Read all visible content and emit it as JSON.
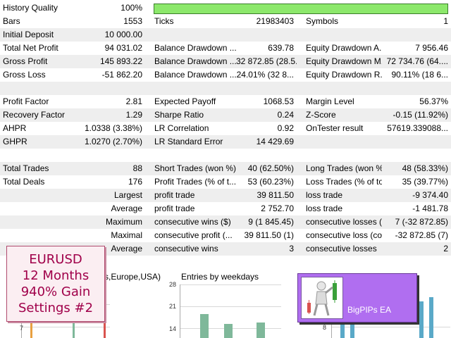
{
  "history_quality": {
    "label": "History Quality",
    "value": "100%",
    "fill_fraction": 1.0
  },
  "rows": [
    {
      "c1l": "Bars",
      "c1v": "1553",
      "c2l": "Ticks",
      "c2v": "21983403",
      "c3l": "Symbols",
      "c3v": "1"
    },
    {
      "c1l": "Initial Deposit",
      "c1v": "10 000.00",
      "c2l": "",
      "c2v": "",
      "c3l": "",
      "c3v": ""
    },
    {
      "c1l": "Total Net Profit",
      "c1v": "94 031.02",
      "c2l": "Balance Drawdown ...",
      "c2v": "639.78",
      "c3l": "Equity Drawdown A...",
      "c3v": "7 956.46"
    },
    {
      "c1l": "Gross Profit",
      "c1v": "145 893.22",
      "c2l": "Balance Drawdown ...",
      "c2v": "32 872.85 (28.5...",
      "c3l": "Equity Drawdown M...",
      "c3v": "72 734.76 (64...."
    },
    {
      "c1l": "Gross Loss",
      "c1v": "-51 862.20",
      "c2l": "Balance Drawdown ...",
      "c2v": "24.01% (32 8...",
      "c3l": "Equity Drawdown R...",
      "c3v": "90.11% (18 6..."
    },
    {
      "c1l": "",
      "c1v": "",
      "c2l": "",
      "c2v": "",
      "c3l": "",
      "c3v": ""
    },
    {
      "c1l": "Profit Factor",
      "c1v": "2.81",
      "c2l": "Expected Payoff",
      "c2v": "1068.53",
      "c3l": "Margin Level",
      "c3v": "56.37%"
    },
    {
      "c1l": "Recovery Factor",
      "c1v": "1.29",
      "c2l": "Sharpe Ratio",
      "c2v": "0.24",
      "c3l": "Z-Score",
      "c3v": "-0.15 (11.92%)"
    },
    {
      "c1l": "AHPR",
      "c1v": "1.0338 (3.38%)",
      "c2l": "LR Correlation",
      "c2v": "0.92",
      "c3l": "OnTester result",
      "c3v": "57619.339088..."
    },
    {
      "c1l": "GHPR",
      "c1v": "1.0270 (2.70%)",
      "c2l": "LR Standard Error",
      "c2v": "14 429.69",
      "c3l": "",
      "c3v": ""
    },
    {
      "c1l": "",
      "c1v": "",
      "c2l": "",
      "c2v": "",
      "c3l": "",
      "c3v": ""
    },
    {
      "c1l": "Total Trades",
      "c1v": "88",
      "c2l": "Short Trades (won %)",
      "c2v": "40 (62.50%)",
      "c3l": "Long Trades (won %)",
      "c3v": "48 (58.33%)"
    },
    {
      "c1l": "Total Deals",
      "c1v": "176",
      "c2l": "Profit Trades (% of t...",
      "c2v": "53 (60.23%)",
      "c3l": "Loss Trades (% of to...",
      "c3v": "35 (39.77%)"
    },
    {
      "c1l": "",
      "c1v": "Largest",
      "c2l": "profit trade",
      "c2v": "39 811.50",
      "c3l": "loss trade",
      "c3v": "-9 374.40"
    },
    {
      "c1l": "",
      "c1v": "Average",
      "c2l": "profit trade",
      "c2v": "2 752.70",
      "c3l": "loss trade",
      "c3v": "-1 481.78"
    },
    {
      "c1l": "",
      "c1v": "Maximum",
      "c2l": "consecutive wins ($)",
      "c2v": "9 (1 845.45)",
      "c3l": "consecutive losses ($)",
      "c3v": "7 (-32 872.85)"
    },
    {
      "c1l": "",
      "c1v": "Maximal",
      "c2l": "consecutive profit (...",
      "c2v": "39 811.50 (1)",
      "c3l": "consecutive loss (co...",
      "c3v": "-32 872.85 (7)"
    },
    {
      "c1l": "",
      "c1v": "Average",
      "c2l": "consecutive wins",
      "c2v": "3",
      "c3l": "consecutive losses",
      "c3v": "2"
    }
  ],
  "charts": {
    "sessions_title": "s,Europe,USA)",
    "sessions_tick": "7",
    "weekdays_title": "Entries by weekdays",
    "weekdays_ticks": [
      "28",
      "21",
      "14"
    ],
    "right_tick": "8"
  },
  "promo": {
    "line1": "EURUSD",
    "line2": "12 Months",
    "line3": "940% Gain",
    "line4": "Settings #2"
  },
  "ea_badge": {
    "label": "BigPIPs EA"
  },
  "colors": {
    "quality_bar": "#8ce86b",
    "promo_text": "#a0004a",
    "badge_bg": "#b06ef0",
    "bar_green": "#7fb89a",
    "bar_blue": "#5aa9c8",
    "bar_red": "#d9534f",
    "bar_orange": "#e8a040"
  }
}
